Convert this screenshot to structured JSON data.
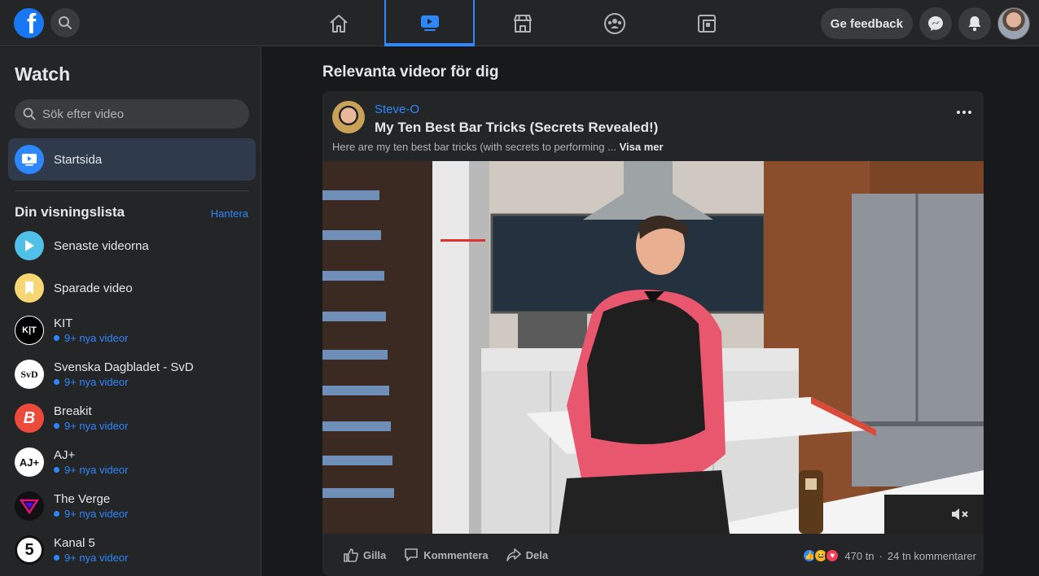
{
  "topbar": {
    "logo_letter": "f",
    "feedback_label": "Ge feedback",
    "nav_tabs": [
      "home-icon",
      "watch-icon",
      "marketplace-icon",
      "groups-icon",
      "gaming-icon"
    ],
    "active_tab": "watch-icon",
    "accent_color": "#2d88ff"
  },
  "sidebar": {
    "title": "Watch",
    "search_placeholder": "Sök efter video",
    "home_label": "Startsida",
    "watchlist_title": "Din visningslista",
    "manage_label": "Hantera",
    "items": [
      {
        "label": "Senaste videorna",
        "sub": ""
      },
      {
        "label": "Sparade video",
        "sub": ""
      },
      {
        "label": "KIT",
        "sub": "9+ nya videor"
      },
      {
        "label": "Svenska Dagbladet - SvD",
        "sub": "9+ nya videor"
      },
      {
        "label": "Breakit",
        "sub": "9+ nya videor"
      },
      {
        "label": "AJ+",
        "sub": "9+ nya videor"
      },
      {
        "label": "The Verge",
        "sub": "9+ nya videor"
      },
      {
        "label": "Kanal 5",
        "sub": "9+ nya videor"
      }
    ],
    "badges": {
      "kit": "K|T",
      "svd": "SvD",
      "breakit": "B",
      "aj": "AJ+",
      "kanal5": "5"
    }
  },
  "main": {
    "heading": "Relevanta videor för dig",
    "post": {
      "channel": "Steve-O",
      "title": "My Ten Best Bar Tricks (Secrets Revealed!)",
      "description": "Here are my ten best bar tricks (with secrets to performing ...",
      "see_more": "Visa mer",
      "actions": {
        "like": "Gilla",
        "comment": "Kommentera",
        "share": "Dela"
      },
      "reaction_count": "470 tn",
      "comment_count": "24 tn kommentarer",
      "separator": "·"
    }
  }
}
